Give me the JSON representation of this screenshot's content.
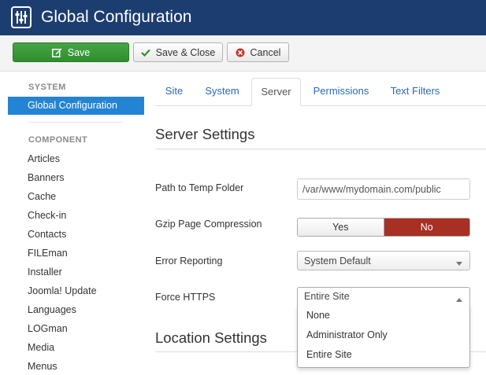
{
  "header": {
    "title": "Global Configuration",
    "icon": "sliders-icon",
    "background": "#1c3d70"
  },
  "toolbar": {
    "save_label": "Save",
    "save_close_label": "Save & Close",
    "cancel_label": "Cancel"
  },
  "sidebar": {
    "system_heading": "SYSTEM",
    "active_item": "Global Configuration",
    "component_heading": "COMPONENT",
    "items": [
      "Articles",
      "Banners",
      "Cache",
      "Check-in",
      "Contacts",
      "FILEman",
      "Installer",
      "Joomla! Update",
      "Languages",
      "LOGman",
      "Media",
      "Menus"
    ]
  },
  "tabs": {
    "items": [
      "Site",
      "System",
      "Server",
      "Permissions",
      "Text Filters"
    ],
    "active": "Server"
  },
  "server": {
    "title": "Server Settings",
    "temp_folder_label": "Path to Temp Folder",
    "temp_folder_value": "/var/www/mydomain.com/public",
    "gzip_label": "Gzip Page Compression",
    "gzip_yes": "Yes",
    "gzip_no": "No",
    "gzip_selected": "No",
    "error_reporting_label": "Error Reporting",
    "error_reporting_value": "System Default",
    "force_https_label": "Force HTTPS",
    "force_https_value": "Entire Site",
    "force_https_options": [
      "None",
      "Administrator Only",
      "Entire Site"
    ]
  },
  "location": {
    "title": "Location Settings"
  },
  "colors": {
    "save_green": "#46a546",
    "active_blue": "#2384d3",
    "no_red": "#a82f24",
    "link_blue": "#2a69b8"
  }
}
